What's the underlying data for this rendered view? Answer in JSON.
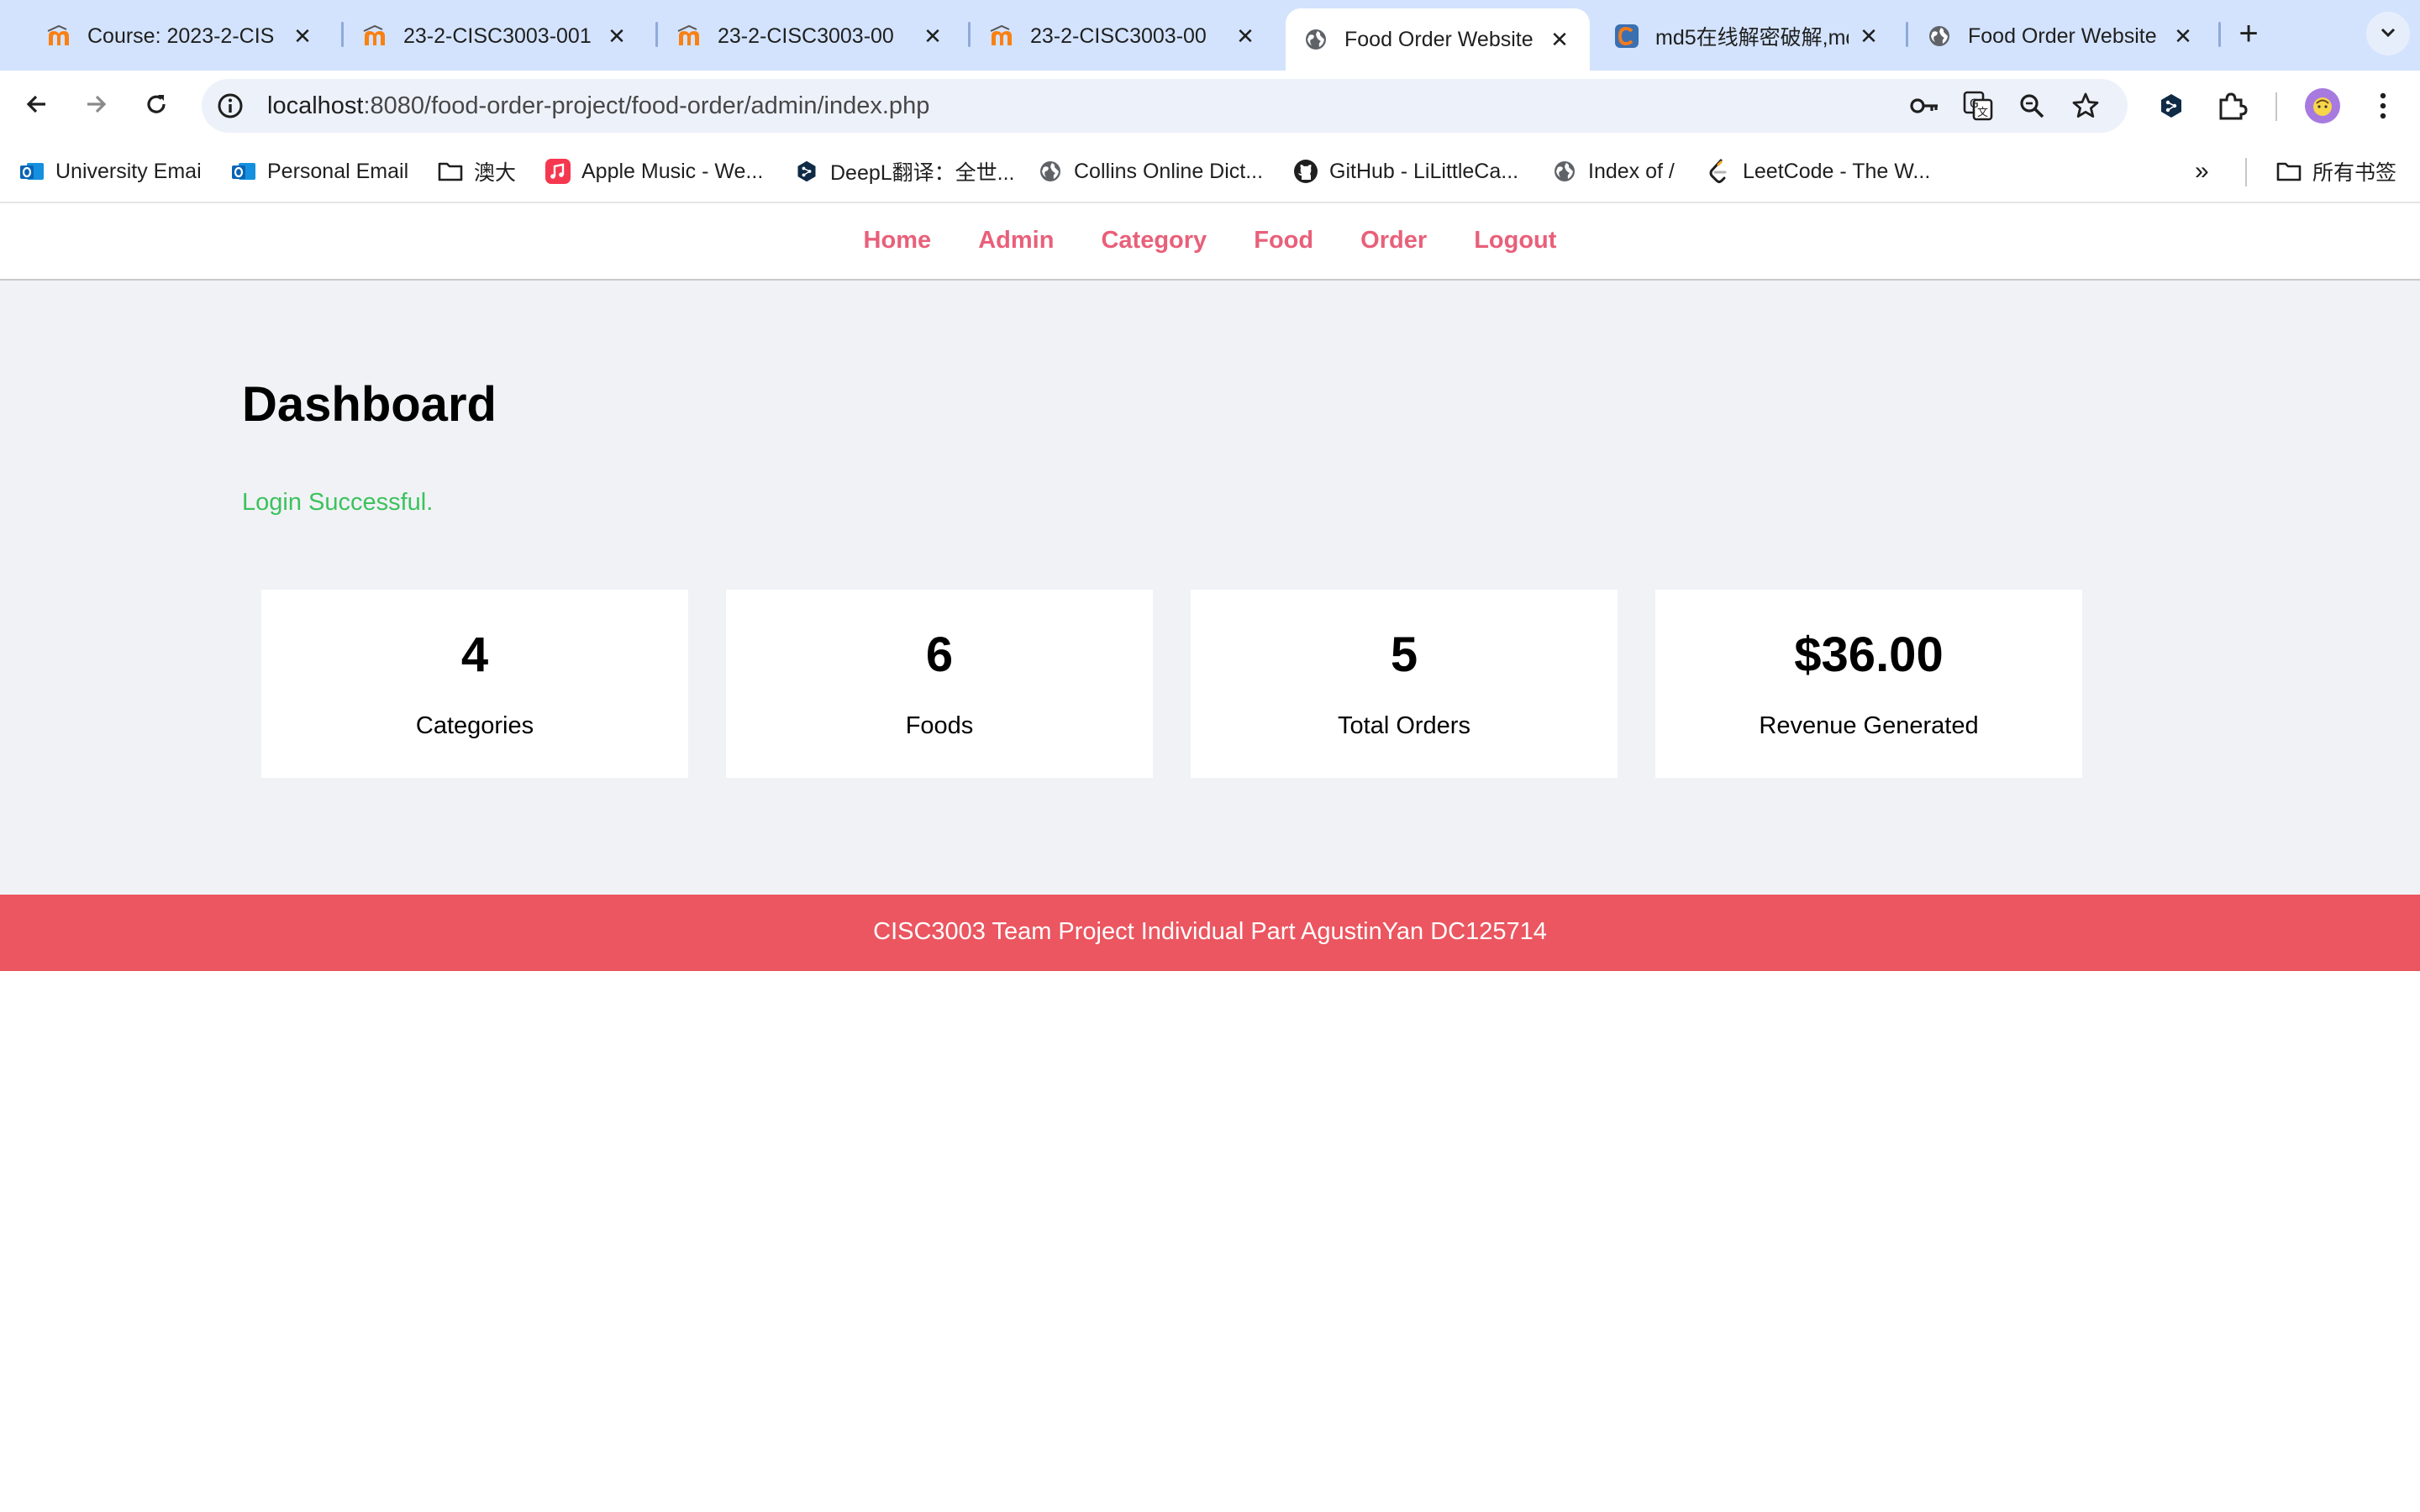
{
  "browser": {
    "tabs": [
      {
        "title": "Course: 2023-2-CIS",
        "favicon": "moodle-icon"
      },
      {
        "title": "23-2-CISC3003-001",
        "favicon": "moodle-icon"
      },
      {
        "title": "23-2-CISC3003-00",
        "favicon": "moodle-icon"
      },
      {
        "title": "23-2-CISC3003-00",
        "favicon": "moodle-icon"
      },
      {
        "title": "Food Order Website",
        "favicon": "globe-icon",
        "active": true
      },
      {
        "title": "md5在线解密破解,md",
        "favicon": "cmd5-icon"
      },
      {
        "title": "Food Order Website",
        "favicon": "globe-icon"
      }
    ],
    "new_tab_label": "+",
    "address": {
      "host": "localhost",
      "rest": ":8080/food-order-project/food-order/admin/index.php"
    },
    "bookmarks": [
      {
        "label": "University Emai",
        "icon": "outlook-icon"
      },
      {
        "label": "Personal Email",
        "icon": "outlook-icon"
      },
      {
        "label": "澳大",
        "icon": "folder-icon"
      },
      {
        "label": "Apple Music - We...",
        "icon": "apple-music-icon"
      },
      {
        "label": "DeepL翻译：全世...",
        "icon": "deepl-icon"
      },
      {
        "label": "Collins Online Dict...",
        "icon": "globe-icon"
      },
      {
        "label": "GitHub - LiLittleCa...",
        "icon": "github-icon"
      },
      {
        "label": "Index of /",
        "icon": "globe-icon"
      },
      {
        "label": "LeetCode - The W...",
        "icon": "leetcode-icon"
      }
    ],
    "bookmarks_overflow": "»",
    "all_bookmarks": "所有书签",
    "accent_color": "#d3e3fd"
  },
  "page": {
    "menu": {
      "home": "Home",
      "admin": "Admin",
      "category": "Category",
      "food": "Food",
      "order": "Order",
      "logout": "Logout"
    },
    "title": "Dashboard",
    "message": "Login Successful.",
    "cards": [
      {
        "value": "4",
        "label": "Categories"
      },
      {
        "value": "6",
        "label": "Foods"
      },
      {
        "value": "5",
        "label": "Total Orders"
      },
      {
        "value": "$36.00",
        "label": "Revenue Generated"
      }
    ],
    "footer": "CISC3003 Team Project Individual Part AgustinYan DC125714",
    "colors": {
      "link": "#e8607a",
      "success": "#3cc25d",
      "footer_bg": "#eb5660",
      "main_bg": "#f1f2f6"
    }
  }
}
